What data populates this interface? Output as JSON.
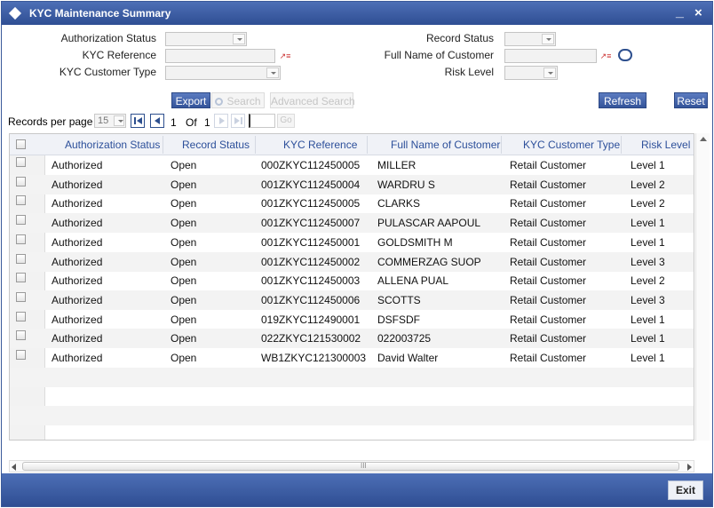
{
  "window": {
    "title": "KYC Maintenance Summary",
    "minimize_glyph": "_",
    "close_glyph": "×"
  },
  "search": {
    "authorization_status_label": "Authorization Status",
    "kyc_reference_label": "KYC Reference",
    "kyc_customer_type_label": "KYC Customer Type",
    "record_status_label": "Record Status",
    "full_name_label": "Full Name of Customer",
    "risk_level_label": "Risk Level",
    "lov_glyph": "↗≡"
  },
  "toolbar": {
    "export_label": "Export",
    "search_label": "Search",
    "advanced_search_label": "Advanced Search",
    "refresh_label": "Refresh",
    "reset_label": "Reset"
  },
  "pager": {
    "records_per_page_label": "Records per page",
    "records_per_page_value": "15",
    "current_page": "1",
    "of_label": "Of",
    "total_pages": "1",
    "go_label": "Go"
  },
  "table": {
    "columns": [
      "Authorization Status",
      "Record Status",
      "KYC Reference",
      "Full Name of Customer",
      "KYC Customer Type",
      "Risk Level"
    ],
    "rows": [
      [
        "Authorized",
        "Open",
        "000ZKYC112450005",
        "MILLER",
        "Retail Customer",
        "Level 1"
      ],
      [
        "Authorized",
        "Open",
        "001ZKYC112450004",
        "WARDRU S",
        "Retail Customer",
        "Level 2"
      ],
      [
        "Authorized",
        "Open",
        "001ZKYC112450005",
        "CLARKS",
        "Retail Customer",
        "Level 2"
      ],
      [
        "Authorized",
        "Open",
        "001ZKYC112450007",
        "PULASCAR AAPOUL",
        "Retail Customer",
        "Level 1"
      ],
      [
        "Authorized",
        "Open",
        "001ZKYC112450001",
        "GOLDSMITH M",
        "Retail Customer",
        "Level 1"
      ],
      [
        "Authorized",
        "Open",
        "001ZKYC112450002",
        "COMMERZAG SUOP",
        "Retail Customer",
        "Level 3"
      ],
      [
        "Authorized",
        "Open",
        "001ZKYC112450003",
        "ALLENA PUAL",
        "Retail Customer",
        "Level 2"
      ],
      [
        "Authorized",
        "Open",
        "001ZKYC112450006",
        "SCOTTS",
        "Retail Customer",
        "Level 3"
      ],
      [
        "Authorized",
        "Open",
        "019ZKYC112490001",
        "DSFSDF",
        "Retail Customer",
        "Level 1"
      ],
      [
        "Authorized",
        "Open",
        "022ZKYC121530002",
        "022003725",
        "Retail Customer",
        "Level 1"
      ],
      [
        "Authorized",
        "Open",
        "WB1ZKYC121300003",
        "David Walter",
        "Retail Customer",
        "Level 1"
      ]
    ]
  },
  "scrollbar": {
    "grip_glyph": "III"
  },
  "footer": {
    "exit_label": "Exit"
  },
  "colors": {
    "header_bar": "#3a5ba3",
    "column_header_text": "#2c4f9a",
    "primary_button": "#4565ad"
  }
}
